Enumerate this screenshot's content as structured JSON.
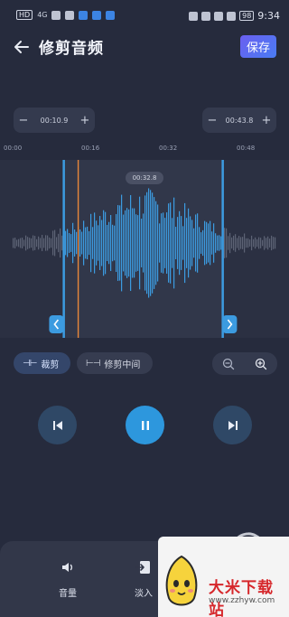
{
  "status_bar": {
    "left_badge": "HD",
    "signal": "4G",
    "time": "9:34",
    "battery": "98"
  },
  "header": {
    "title": "修剪音频",
    "save_label": "保存"
  },
  "trim": {
    "start_time": "00:10.9",
    "end_time": "00:43.8",
    "selection_duration": "00:32.8",
    "minus_symbol": "−",
    "plus_symbol": "+"
  },
  "timeline": {
    "tick_labels": [
      "00:00",
      "00:16",
      "00:32",
      "00:48"
    ],
    "playhead_fraction": 0.27,
    "selection_start_fraction": 0.22,
    "selection_end_fraction": 0.77
  },
  "colors": {
    "accent": "#2d97dd",
    "waveform_selected": "#3c9be0",
    "waveform_unselected": "#5d6375",
    "playhead": "#e8873a",
    "save_button": "#5a6cf0"
  },
  "mode_chips": [
    {
      "label": "裁剪",
      "icon": "trim-ends-icon",
      "active": true
    },
    {
      "label": "修剪中间",
      "icon": "trim-middle-icon",
      "active": false
    }
  ],
  "zoom": {
    "out_icon": "zoom-out-icon",
    "in_icon": "zoom-in-icon"
  },
  "transport": {
    "prev_icon": "skip-previous-icon",
    "play_icon": "pause-icon",
    "next_icon": "skip-next-icon"
  },
  "tools": [
    {
      "label": "音量",
      "icon": "volume-icon"
    },
    {
      "label": "淡入",
      "icon": "fade-in-icon"
    }
  ],
  "watermark": {
    "title": "大米下载站",
    "url": "www.zzhyw.com"
  }
}
